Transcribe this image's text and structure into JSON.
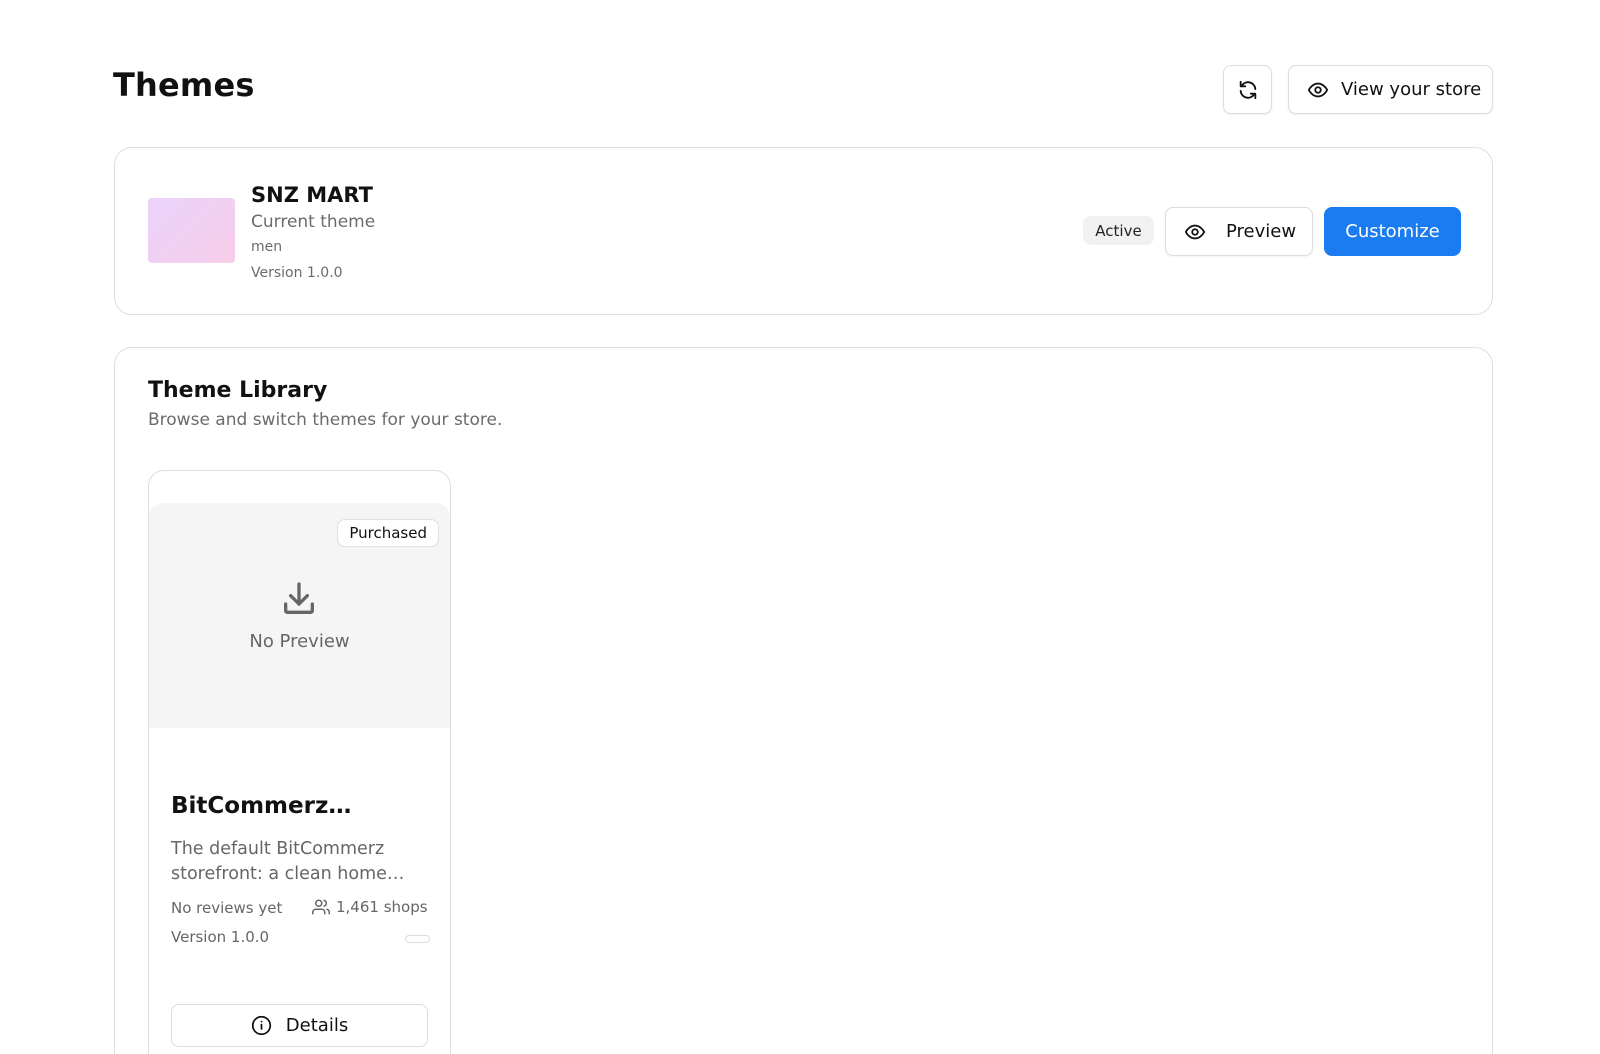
{
  "header": {
    "title": "Themes",
    "refresh_icon": "refresh-icon",
    "view_store_label": "View your store",
    "view_store_icon": "eye-icon"
  },
  "current_theme": {
    "name": "SNZ MART",
    "subtitle": "Current theme",
    "tag": "men",
    "version": "Version 1.0.0",
    "status_badge": "Active",
    "preview_label": "Preview",
    "customize_label": "Customize",
    "accent_color": "#1a7cf0",
    "thumbnail_colors": [
      "#ead2fb",
      "#f7cde9"
    ]
  },
  "library": {
    "title": "Theme Library",
    "subtitle": "Browse and switch themes for your store.",
    "themes": [
      {
        "badge": "Purchased",
        "preview_placeholder": "No Preview",
        "preview_icon": "download-icon",
        "name": "BitCommerz…",
        "description": "The default BitCommerz storefront: a clean home…",
        "reviews": "No reviews yet",
        "shops": "1,461 shops",
        "shops_icon": "users-icon",
        "version": "Version 1.0.0",
        "details_label": "Details",
        "details_icon": "info-icon"
      }
    ]
  }
}
